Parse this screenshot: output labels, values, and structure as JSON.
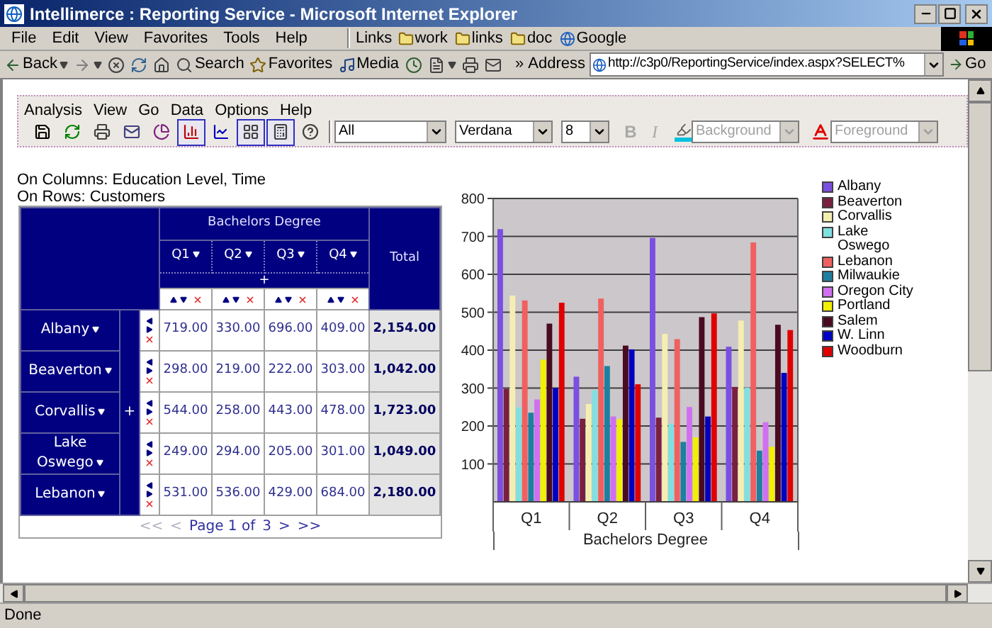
{
  "window": {
    "title": "Intellimerce : Reporting Service - Microsoft Internet Explorer"
  },
  "menu_bar": [
    "File",
    "Edit",
    "View",
    "Favorites",
    "Tools",
    "Help"
  ],
  "links_bar": {
    "label": "Links",
    "links": [
      {
        "kind": "folder",
        "label": "work"
      },
      {
        "kind": "folder",
        "label": "links"
      },
      {
        "kind": "folder",
        "label": "doc"
      },
      {
        "kind": "web",
        "label": "Google"
      }
    ]
  },
  "nav_toolbar": {
    "buttons": [
      {
        "kind": "back",
        "label": "Back",
        "menu": true
      },
      {
        "kind": "forward",
        "menu": true
      },
      {
        "kind": "stop"
      },
      {
        "kind": "refresh"
      },
      {
        "kind": "home"
      },
      {
        "kind": "search",
        "label": "Search"
      },
      {
        "kind": "favorites",
        "label": "Favorites"
      },
      {
        "kind": "media",
        "label": "Media"
      },
      {
        "kind": "history"
      },
      {
        "kind": "edit",
        "menu": true
      },
      {
        "kind": "print"
      },
      {
        "kind": "mail"
      }
    ],
    "overflow": "»",
    "address_label": "Address",
    "url": "http://c3p0/ReportingService/index.aspx?SELECT%",
    "go": "Go"
  },
  "app_menu": [
    "Analysis",
    "View",
    "Go",
    "Data",
    "Options",
    "Help"
  ],
  "app_toolbar": {
    "tools": [
      {
        "kind": "save",
        "selected": false
      },
      {
        "kind": "refresh",
        "selected": false
      },
      {
        "kind": "print",
        "selected": false
      },
      {
        "kind": "mail",
        "selected": false
      },
      {
        "kind": "pie",
        "selected": false
      },
      {
        "kind": "bar",
        "selected": true
      },
      {
        "kind": "line",
        "selected": false
      },
      {
        "kind": "properties",
        "selected": true
      },
      {
        "kind": "calculator",
        "selected": true
      },
      {
        "kind": "help",
        "selected": false
      }
    ],
    "filter": "All",
    "font": "Verdana",
    "size": "8",
    "bold": {
      "label": "B",
      "disabled": true
    },
    "italic": {
      "label": "I",
      "disabled": true
    },
    "background": {
      "value": "Background",
      "disabled": true
    },
    "foreground": {
      "value": "Foreground",
      "disabled": true
    }
  },
  "axes": [
    "On Columns: Education Level, Time",
    "On Rows: Customers"
  ],
  "pivot": {
    "column_group": "Bachelors Degree",
    "columns": [
      "Q1",
      "Q2",
      "Q3",
      "Q4"
    ],
    "expand_columns": "+",
    "total_label": "Total",
    "expand_rows": "+",
    "rows": [
      {
        "label": "Albany",
        "values": [
          "719.00",
          "330.00",
          "696.00",
          "409.00"
        ],
        "total": "2,154.00"
      },
      {
        "label": "Beaverton",
        "values": [
          "298.00",
          "219.00",
          "222.00",
          "303.00"
        ],
        "total": "1,042.00"
      },
      {
        "label": "Corvallis",
        "values": [
          "544.00",
          "258.00",
          "443.00",
          "478.00"
        ],
        "total": "1,723.00"
      },
      {
        "label": "Lake Oswego",
        "values": [
          "249.00",
          "294.00",
          "205.00",
          "301.00"
        ],
        "total": "1,049.00"
      },
      {
        "label": "Lebanon",
        "values": [
          "531.00",
          "536.00",
          "429.00",
          "684.00"
        ],
        "total": "2,180.00"
      }
    ],
    "pager": [
      {
        "kind": "link",
        "label": "<<",
        "disabled": true
      },
      {
        "kind": "link",
        "label": "<",
        "disabled": true
      },
      {
        "kind": "text",
        "label": "Page 1 of"
      },
      {
        "kind": "link",
        "label": "3",
        "disabled": false
      },
      {
        "kind": "link",
        "label": ">",
        "disabled": false
      },
      {
        "kind": "link",
        "label": ">>",
        "disabled": false
      }
    ]
  },
  "chart": {
    "chart_data": {
      "type": "bar",
      "grid": true,
      "xlabel": "Bachelors Degree",
      "categories": [
        "Q1",
        "Q2",
        "Q3",
        "Q4"
      ],
      "ylim": [
        0,
        800
      ],
      "yticks": [
        100,
        200,
        300,
        400,
        500,
        600,
        700,
        800
      ],
      "series": [
        {
          "name": "Albany",
          "color": "#7b4fe0",
          "values": [
            719,
            330,
            696,
            409
          ]
        },
        {
          "name": "Beaverton",
          "color": "#7a1f3f",
          "values": [
            298,
            219,
            222,
            303
          ]
        },
        {
          "name": "Corvallis",
          "color": "#f4efb0",
          "values": [
            544,
            258,
            443,
            478
          ]
        },
        {
          "name": "Lake Oswego",
          "color": "#80e0e0",
          "values": [
            249,
            294,
            205,
            301
          ]
        },
        {
          "name": "Lebanon",
          "color": "#f06060",
          "values": [
            531,
            536,
            429,
            684
          ]
        },
        {
          "name": "Milwaukie",
          "color": "#1f7fa0",
          "values": [
            235,
            358,
            158,
            135
          ]
        },
        {
          "name": "Oregon City",
          "color": "#d070f0",
          "values": [
            270,
            225,
            250,
            210
          ]
        },
        {
          "name": "Portland",
          "color": "#f0f000",
          "values": [
            375,
            218,
            170,
            145
          ]
        },
        {
          "name": "Salem",
          "color": "#4a0a20",
          "values": [
            470,
            412,
            487,
            467
          ]
        },
        {
          "name": "W. Linn",
          "color": "#0000c0",
          "values": [
            300,
            402,
            225,
            340
          ]
        },
        {
          "name": "Woodburn",
          "color": "#e00000",
          "values": [
            525,
            310,
            497,
            453
          ]
        }
      ]
    }
  },
  "status_bar": "Done"
}
